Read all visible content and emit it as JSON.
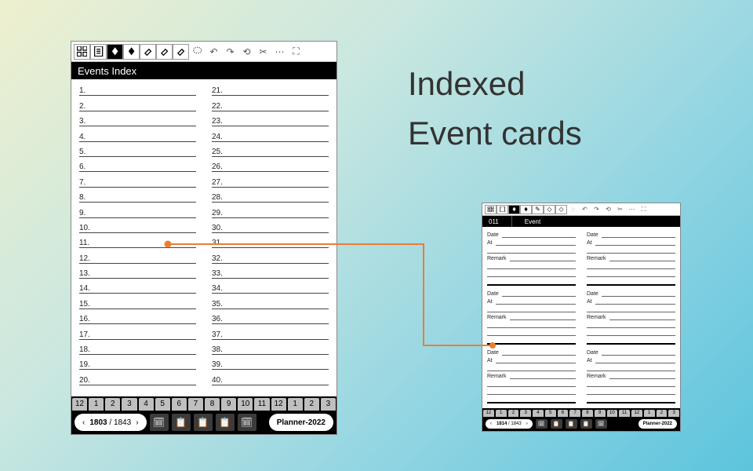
{
  "heading_line1": "Indexed",
  "heading_line2": "Event cards",
  "large": {
    "title": "Events Index",
    "rows_left": [
      "1.",
      "2.",
      "3.",
      "4.",
      "5.",
      "6.",
      "7.",
      "8.",
      "9.",
      "10.",
      "11.",
      "12.",
      "13.",
      "14.",
      "15.",
      "16.",
      "17.",
      "18.",
      "19.",
      "20."
    ],
    "rows_right": [
      "21.",
      "22.",
      "23.",
      "24.",
      "25.",
      "26.",
      "27.",
      "28.",
      "29.",
      "30.",
      "31.",
      "32.",
      "33.",
      "34.",
      "35.",
      "36.",
      "37.",
      "38.",
      "39.",
      "40."
    ],
    "months": [
      "12",
      "1",
      "2",
      "3",
      "4",
      "5",
      "6",
      "7",
      "8",
      "9",
      "10",
      "11",
      "12",
      "1",
      "2",
      "3"
    ],
    "pager_current": "1803",
    "pager_total": "1843",
    "planner_label": "Planner-2022"
  },
  "small": {
    "card_no": "011",
    "card_title": "Event",
    "labels": {
      "date": "Date",
      "at": "At",
      "remark": "Remark"
    },
    "months": [
      "12",
      "1",
      "2",
      "3",
      "4",
      "5",
      "6",
      "7",
      "8",
      "9",
      "10",
      "11",
      "12",
      "1",
      "2",
      "3"
    ],
    "pager_current": "1814",
    "pager_total": "1843",
    "planner_label": "Planner-2022"
  },
  "icons": {
    "undo": "↶",
    "redo": "↷",
    "back": "⟲",
    "cut": "✂",
    "more": "⋯",
    "expand": "⛶",
    "prev": "‹",
    "next": "›",
    "cal": "🗓",
    "clip": "📋"
  }
}
